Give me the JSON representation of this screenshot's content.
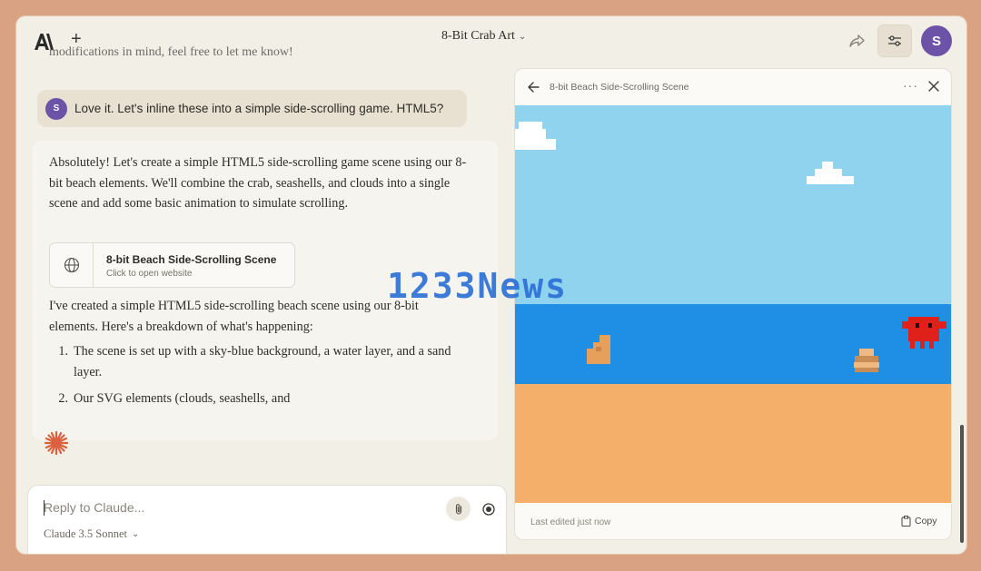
{
  "header": {
    "title": "8-Bit Crab Art",
    "avatar_letter": "S"
  },
  "conversation": {
    "previous_text": "modifications in mind, feel free to let me know!",
    "user_message": {
      "avatar_letter": "S",
      "text": "Love it. Let's inline these into a simple side-scrolling game. HTML5?"
    },
    "assistant": {
      "paragraph1": "Absolutely! Let's create a simple HTML5 side-scrolling game scene using our 8-bit beach elements. We'll combine the crab, seashells, and clouds into a single scene and add some basic animation to simulate scrolling.",
      "artifact": {
        "title": "8-bit Beach Side-Scrolling Scene",
        "subtitle": "Click to open website"
      },
      "paragraph2": "I've created a simple HTML5 side-scrolling beach scene using our 8-bit elements. Here's a breakdown of what's happening:",
      "list": [
        {
          "num": "1.",
          "text": "The scene is set up with a sky-blue background, a water layer, and a sand layer."
        },
        {
          "num": "2.",
          "text": "Our SVG elements (clouds, seashells, and"
        }
      ]
    }
  },
  "composer": {
    "placeholder": "Reply to Claude...",
    "model": "Claude 3.5 Sonnet"
  },
  "artifact_panel": {
    "title": "8-bit Beach Side-Scrolling Scene",
    "footer_status": "Last edited just now",
    "copy_label": "Copy",
    "colors": {
      "sky": "#8fd3ef",
      "water": "#1f8fe6",
      "sand": "#f4b06b",
      "crab": "#e0201a",
      "cloud": "#ffffff",
      "shell": "#e6a05c"
    }
  },
  "watermark": "1233News",
  "colors": {
    "accent": "#6c53a8",
    "brand_spark": "#d9613f",
    "background": "#d9a283"
  }
}
